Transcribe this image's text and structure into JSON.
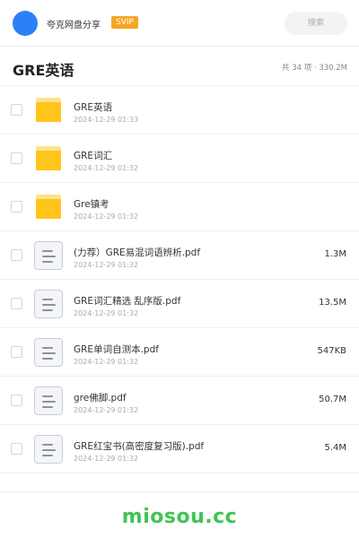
{
  "header": {
    "app_name": "夸克网盘分享",
    "badge": "SVIP",
    "search_placeholder": "搜索"
  },
  "title_bar": {
    "title": "GRE英语",
    "summary": "共 34 项 · 330.2M"
  },
  "items": [
    {
      "type": "folder",
      "icon": "folder-icon",
      "name": "GRE英语",
      "date": "2024-12-29 01:33",
      "size": ""
    },
    {
      "type": "folder",
      "icon": "folder-icon",
      "name": "GRE词汇",
      "date": "2024-12-29 01:32",
      "size": ""
    },
    {
      "type": "folder",
      "icon": "folder-icon",
      "name": "Gre镇考",
      "date": "2024-12-29 01:32",
      "size": ""
    },
    {
      "type": "file",
      "icon": "document-icon",
      "name": "(力荐）GRE易混词语辨析.pdf",
      "date": "2024-12-29 01:32",
      "size": "1.3M"
    },
    {
      "type": "file",
      "icon": "document-icon",
      "name": "GRE词汇精选 乱序版.pdf",
      "date": "2024-12-29 01:32",
      "size": "13.5M"
    },
    {
      "type": "file",
      "icon": "document-icon",
      "name": "GRE单词自测本.pdf",
      "date": "2024-12-29 01:32",
      "size": "547KB"
    },
    {
      "type": "file",
      "icon": "document-icon",
      "name": "gre佛脚.pdf",
      "date": "2024-12-29 01:32",
      "size": "50.7M"
    },
    {
      "type": "file",
      "icon": "document-icon",
      "name": "GRE红宝书(高密度复习版).pdf",
      "date": "2024-12-29 01:32",
      "size": "5.4M"
    }
  ],
  "footer": {
    "watermark": "miosou.cc"
  },
  "colors": {
    "avatar": "#2d7ff9",
    "badge": "#f5a623",
    "folder": "#ffc51a",
    "watermark": "#41c453"
  }
}
